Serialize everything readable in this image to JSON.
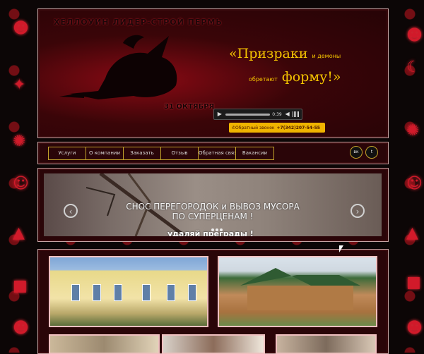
{
  "header": {
    "brand": "ХЕЛЛОУИН ЛИДЕР-СТРОЙ ПЕРМЬ",
    "slogan_part1": "«Призраки",
    "slogan_part2": "и демоны",
    "slogan_part3": "обретают",
    "slogan_part4": "форму!»",
    "date": "31 ОКТЯБРЯ",
    "player": {
      "time": "0:39"
    },
    "callback_label": "Обратный звонок",
    "phone": "+7(342)207-54-55"
  },
  "nav": {
    "items": [
      "Услуги",
      "О компании",
      "Заказать",
      "Отзыв",
      "Обратная связь",
      "Вакансии"
    ],
    "socials": [
      {
        "label": "вк",
        "icon": "vk-icon"
      },
      {
        "label": "t",
        "icon": "twitter-icon"
      }
    ]
  },
  "slider": {
    "line1": "СНОС ПЕРЕГОРОДОК и ВЫВОЗ МУСОРА",
    "line2": "ПО СУПЕРЦЕНАМ !",
    "subtitle": "удаляй преграды !",
    "prev": "‹",
    "next": "›",
    "dots": 3
  },
  "colors": {
    "accent": "#f5c400",
    "panel": "#2a0508",
    "border": "#c7a4a4",
    "background": "#0c0606"
  }
}
